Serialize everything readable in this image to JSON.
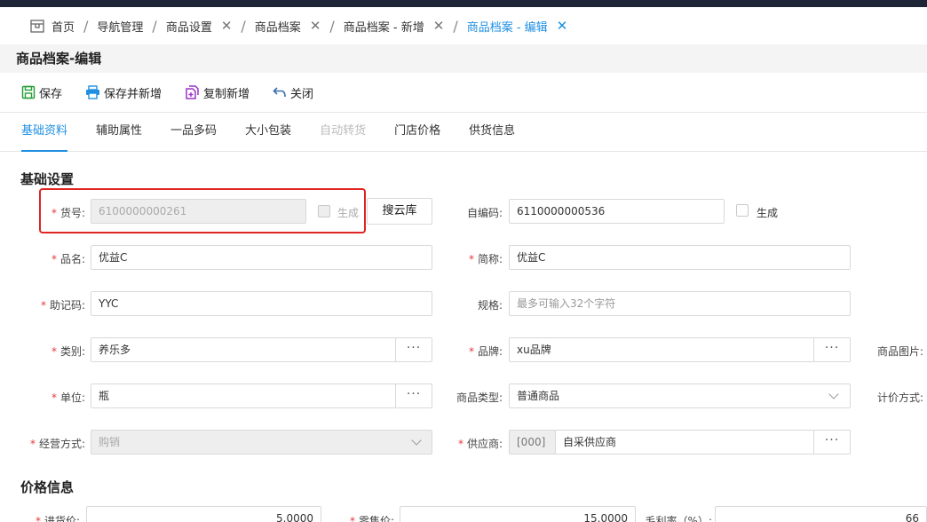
{
  "nav_tabs": [
    {
      "label": "首页",
      "closable": false,
      "active": false
    },
    {
      "label": "导航管理",
      "closable": false,
      "active": false
    },
    {
      "label": "商品设置",
      "closable": true,
      "active": false
    },
    {
      "label": "商品档案",
      "closable": true,
      "active": false
    },
    {
      "label": "商品档案 - 新增",
      "closable": true,
      "active": false
    },
    {
      "label": "商品档案 - 编辑",
      "closable": true,
      "active": true
    }
  ],
  "page_title": "商品档案-编辑",
  "toolbar": {
    "save": "保存",
    "save_and_new": "保存并新增",
    "copy_new": "复制新增",
    "close": "关闭"
  },
  "sub_tabs": [
    {
      "label": "基础资料",
      "state": "active"
    },
    {
      "label": "辅助属性",
      "state": "normal"
    },
    {
      "label": "一品多码",
      "state": "normal"
    },
    {
      "label": "大小包装",
      "state": "normal"
    },
    {
      "label": "自动转货",
      "state": "disabled"
    },
    {
      "label": "门店价格",
      "state": "normal"
    },
    {
      "label": "供货信息",
      "state": "normal"
    }
  ],
  "section_basic": "基础设置",
  "form": {
    "item_no": {
      "label": "货号:",
      "value": "6100000000261",
      "gen_label": "生成",
      "search_btn": "搜云库"
    },
    "self_code": {
      "label": "自编码:",
      "value": "6110000000536",
      "gen_label": "生成"
    },
    "name": {
      "label": "品名:",
      "value": "优益C"
    },
    "short_name": {
      "label": "简称:",
      "value": "优益C"
    },
    "mnemonic": {
      "label": "助记码:",
      "value": "YYC"
    },
    "spec": {
      "label": "规格:",
      "placeholder": "最多可输入32个字符"
    },
    "category": {
      "label": "类别:",
      "value": "养乐多",
      "more": "···"
    },
    "brand": {
      "label": "品牌:",
      "value": "xu品牌",
      "more": "···"
    },
    "image_label": "商品图片:",
    "unit": {
      "label": "单位:",
      "value": "瓶",
      "more": "···"
    },
    "goods_type": {
      "label": "商品类型:",
      "value": "普通商品"
    },
    "pricing_label": "计价方式:",
    "business_mode": {
      "label": "经营方式:",
      "value": "购销"
    },
    "supplier": {
      "label": "供应商:",
      "code": "[000]",
      "name": "自采供应商",
      "more": "···"
    }
  },
  "section_price": "价格信息",
  "price": {
    "purchase": {
      "label": "进货价:",
      "value": "5.0000"
    },
    "retail": {
      "label": "零售价:",
      "value": "15.0000"
    },
    "margin": {
      "label": "毛利率（%）:",
      "value": "66"
    }
  }
}
